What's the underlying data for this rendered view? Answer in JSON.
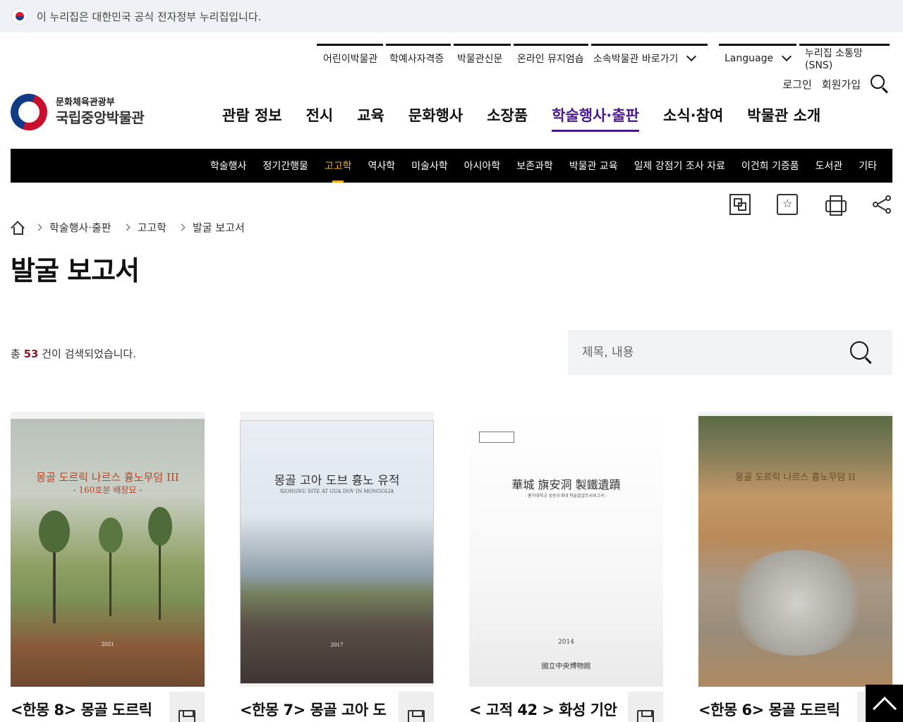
{
  "gov_banner": {
    "text": "이 누리집은 대한민국 공식 전자정부 누리집입니다."
  },
  "utility_nav": {
    "items": [
      "어린이박물관",
      "학예사자격증",
      "박물관신문",
      "온라인 뮤지엄숍",
      "소속박물관 바로가기"
    ],
    "language": "Language",
    "sns": "누리집 소통망(SNS)",
    "login": "로그인",
    "signup": "회원가입"
  },
  "logo": {
    "ministry": "문화체육관광부",
    "name": "국립중앙박물관"
  },
  "main_nav": {
    "items": [
      "관람 정보",
      "전시",
      "교육",
      "문화행사",
      "소장품",
      "학술행사·출판",
      "소식·참여",
      "박물관 소개"
    ],
    "active": "학술행사·출판"
  },
  "sub_nav": {
    "items": [
      "학술행사",
      "정기간행물",
      "고고학",
      "역사학",
      "미술사학",
      "아시아학",
      "보존과학",
      "박물관 교육",
      "일제 강점기 조사 자료",
      "이건희 기증품",
      "도서관",
      "기타"
    ],
    "active": "고고학"
  },
  "breadcrumb": [
    "학술행사·출판",
    "고고학",
    "발굴 보고서"
  ],
  "page_title": "발굴 보고서",
  "results": {
    "prefix": "총",
    "count": "53",
    "suffix": "건이 검색되었습니다."
  },
  "search": {
    "placeholder": "제목, 내용"
  },
  "cards": [
    {
      "title": "<한몽 8> 몽골 도르릭",
      "cover_title": "몽골 도르릭 나르스 흉노무덤 III",
      "cover_subtitle": "- 160호분 배장묘 -",
      "cover_year": "2021",
      "cover_colors": {
        "top": "#b9c2ba",
        "mid": "#7c8f55",
        "bottom": "#8a5a3a"
      }
    },
    {
      "title": "<한몽 7> 몽골 고아 도",
      "cover_title": "몽골 고아 도브 흉노 유적",
      "cover_subtitle": "XIONGNU SITE AT GUA DOV IN MONGOLIA",
      "cover_year": "2017",
      "cover_colors": {
        "top": "#e6ecf2",
        "mid": "#8fa0ac",
        "bottom": "#4a4240"
      }
    },
    {
      "title": "< 고적 42 > 화성 기안",
      "cover_title": "華城 旗安洞 製鐵遺蹟",
      "cover_subtitle": "- 홍익대학교 성승우개대 학술발굴조사보고서 -",
      "cover_year": "2014",
      "cover_publisher": "國立中央博物館",
      "cover_colors": {
        "top": "#ffffff",
        "mid": "#f4f4f4",
        "bottom": "#e6e6e6"
      }
    },
    {
      "title": "<한몽 6> 몽골 도르릭",
      "cover_title": "몽골 도르릭 나르스 흉노무덤 II",
      "cover_subtitle": "",
      "cover_year": "",
      "cover_colors": {
        "top": "#5b6b45",
        "mid": "#b98a5a",
        "bottom": "#9a8c7a"
      }
    }
  ]
}
